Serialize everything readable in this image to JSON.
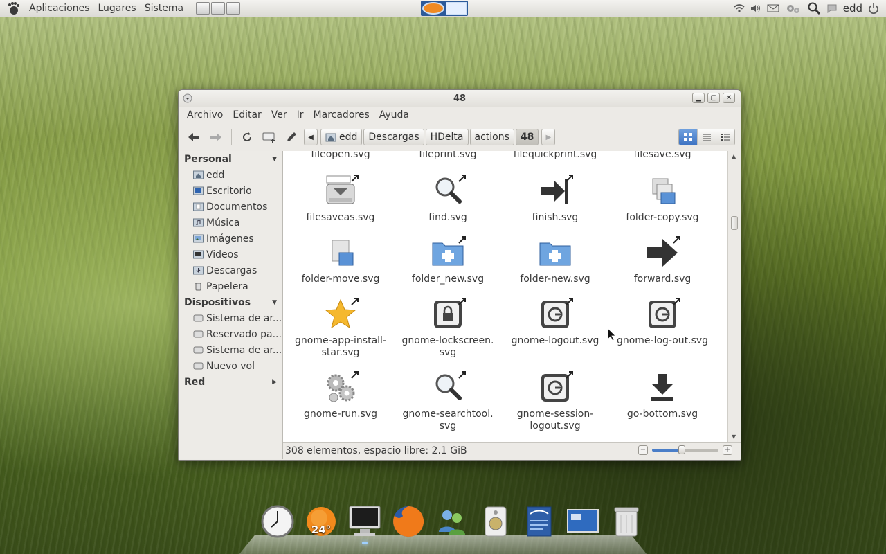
{
  "top_panel": {
    "menus": [
      "Aplicaciones",
      "Lugares",
      "Sistema"
    ],
    "user": "edd"
  },
  "window": {
    "title": "48",
    "menubar": [
      "Archivo",
      "Editar",
      "Ver",
      "Ir",
      "Marcadores",
      "Ayuda"
    ],
    "breadcrumbs": [
      "edd",
      "Descargas",
      "HDelta",
      "actions",
      "48"
    ],
    "sidebar": {
      "personal": {
        "header": "Personal",
        "items": [
          "edd",
          "Escritorio",
          "Documentos",
          "Música",
          "Imágenes",
          "Videos",
          "Descargas",
          "Papelera"
        ]
      },
      "devices": {
        "header": "Dispositivos",
        "items": [
          "Sistema de ar...",
          "Reservado pa...",
          "Sistema de ar...",
          "Nuevo vol"
        ]
      },
      "network": {
        "header": "Red"
      }
    },
    "partial_row": [
      "fileopen.svg",
      "fileprint.svg",
      "filequickprint.svg",
      "filesave.svg"
    ],
    "files": [
      {
        "name": "filesaveas.svg",
        "icon": "save-as-icon"
      },
      {
        "name": "find.svg",
        "icon": "magnifier-icon"
      },
      {
        "name": "finish.svg",
        "icon": "finish-arrow-icon"
      },
      {
        "name": "folder-copy.svg",
        "icon": "folder-copy-icon"
      },
      {
        "name": "folder-move.svg",
        "icon": "folder-move-icon"
      },
      {
        "name": "folder_new.svg",
        "icon": "folder-new-icon"
      },
      {
        "name": "folder-new.svg",
        "icon": "folder-new-icon"
      },
      {
        "name": "forward.svg",
        "icon": "forward-arrow-icon"
      },
      {
        "name": "gnome-app-install-star.svg",
        "line1": "gnome-app-install-",
        "line2": "star.svg",
        "icon": "star-icon"
      },
      {
        "name": "gnome-lockscreen.svg",
        "line1": "gnome-lockscreen.",
        "line2": "svg",
        "icon": "lock-icon"
      },
      {
        "name": "gnome-logout.svg",
        "icon": "logout-icon"
      },
      {
        "name": "gnome-log-out.svg",
        "icon": "logout-icon"
      },
      {
        "name": "gnome-run.svg",
        "icon": "gears-icon"
      },
      {
        "name": "gnome-searchtool.svg",
        "line1": "gnome-searchtool.",
        "line2": "svg",
        "icon": "magnifier-icon"
      },
      {
        "name": "gnome-session-logout.svg",
        "line1": "gnome-session-",
        "line2": "logout.svg",
        "icon": "logout-icon"
      },
      {
        "name": "go-bottom.svg",
        "icon": "go-bottom-icon"
      }
    ],
    "status": "308 elementos, espacio libre: 2.1 GiB",
    "zoom_level": 0.45
  },
  "dock": {
    "items": [
      "clock",
      "weather",
      "computer",
      "firefox",
      "messenger",
      "speaker",
      "openoffice",
      "desktop",
      "trash"
    ],
    "weather_temp": "24°"
  },
  "colors": {
    "accent": "#3f74c3",
    "window_bg": "#eceae6"
  }
}
